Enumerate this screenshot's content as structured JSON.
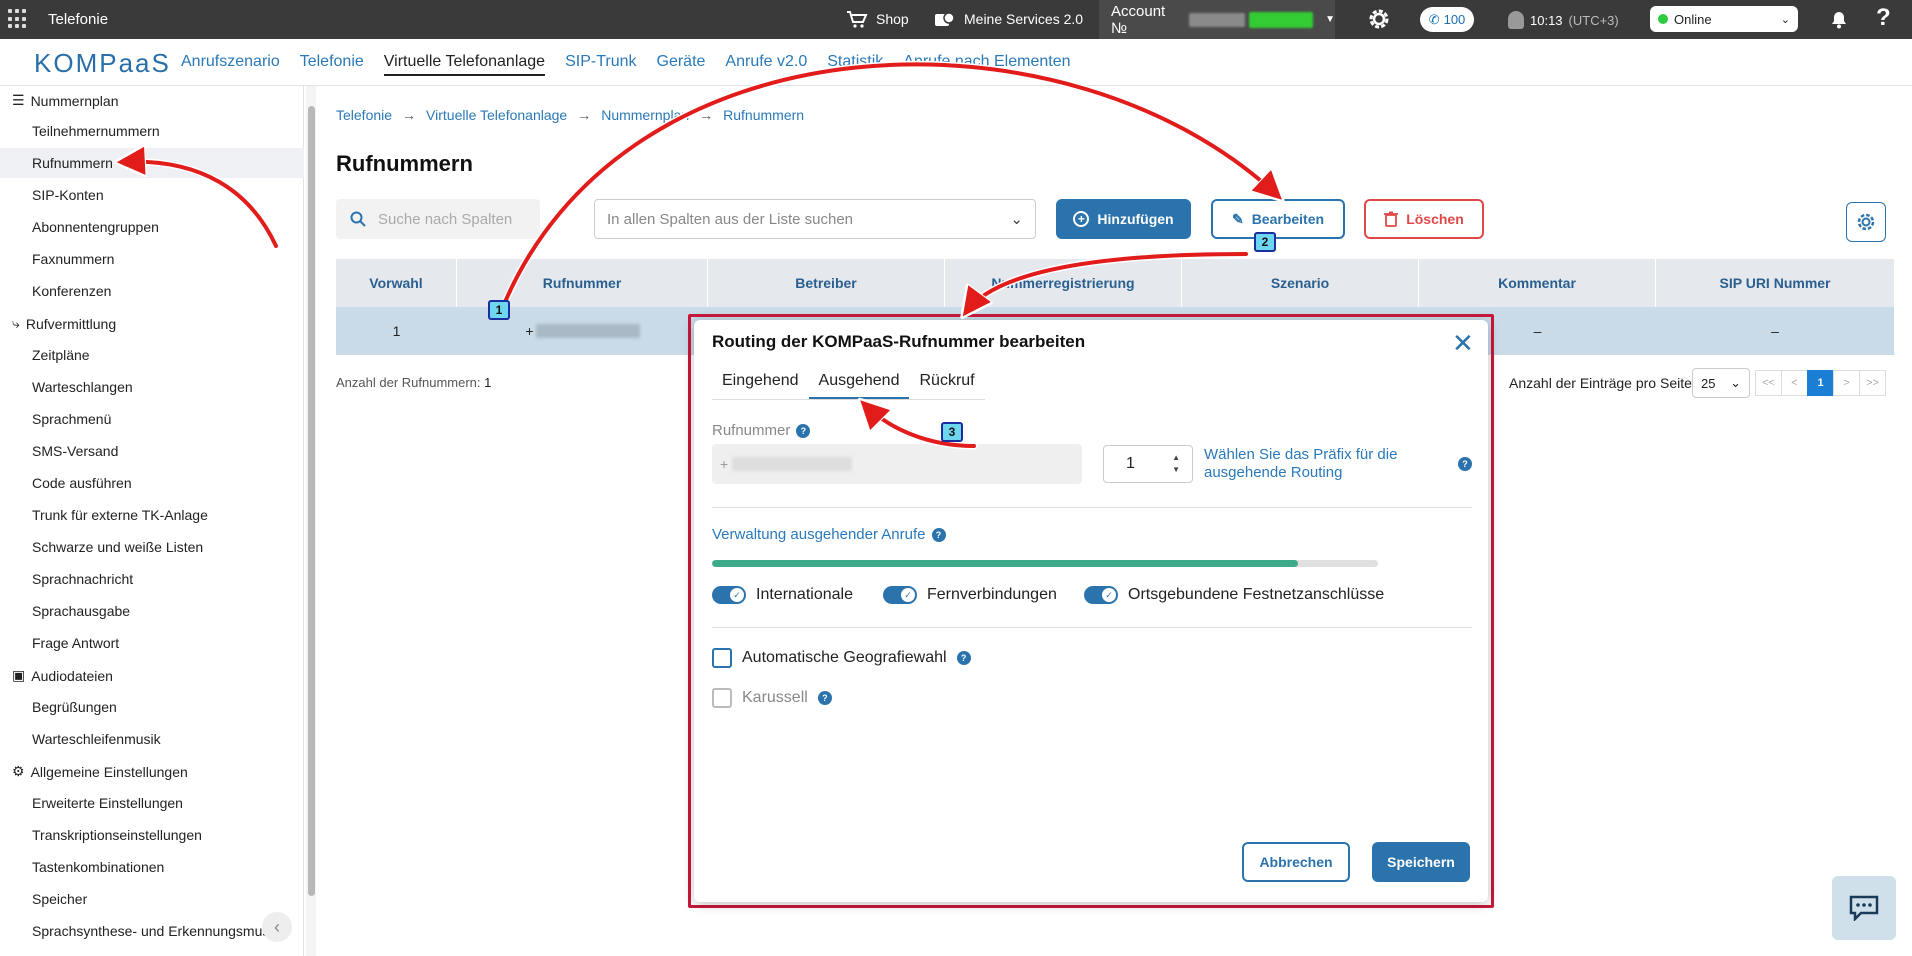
{
  "topbar": {
    "app_title": "Telefonie",
    "shop_label": "Shop",
    "services_label": "Meine Services 2.0",
    "account_label": "Account №",
    "phone_count": "100",
    "time": "10:13",
    "timezone": "(UTC+3)",
    "status": "Online"
  },
  "nav": {
    "logo": "KOMPaaS",
    "links": [
      "Anrufszenario",
      "Telefonie",
      "Virtuelle Telefonanlage",
      "SIP-Trunk",
      "Geräte",
      "Anrufe v2.0",
      "Statistik",
      "Anrufe nach Elementen"
    ],
    "active": "Virtuelle Telefonanlage"
  },
  "sidebar": {
    "groups": [
      {
        "label": "Nummernplan",
        "items": [
          "Teilnehmernummern",
          "Rufnummern",
          "SIP-Konten",
          "Abonnentengruppen",
          "Faxnummern",
          "Konferenzen"
        ]
      },
      {
        "label": "Rufvermittlung",
        "items": [
          "Zeitpläne",
          "Warteschlangen",
          "Sprachmenü",
          "SMS-Versand",
          "Code ausführen",
          "Trunk für externe TK-Anlage",
          "Schwarze und weiße Listen",
          "Sprachnachricht",
          "Sprachausgabe",
          "Frage Antwort"
        ]
      },
      {
        "label": "Audiodateien",
        "items": [
          "Begrüßungen",
          "Warteschleifenmusik"
        ]
      },
      {
        "label": "Allgemeine Einstellungen",
        "items": [
          "Erweiterte Einstellungen",
          "Transkriptionseinstellungen",
          "Tastenkombinationen",
          "Speicher",
          "Sprachsynthese- und Erkennungsmus"
        ]
      }
    ],
    "active_item": "Rufnummern"
  },
  "main": {
    "breadcrumb": [
      "Telefonie",
      "Virtuelle Telefonanlage",
      "Nummernplan",
      "Rufnummern"
    ],
    "title": "Rufnummern",
    "search_placeholder": "Suche nach Spalten",
    "combo_placeholder": "In allen Spalten aus der Liste suchen",
    "add_label": "Hinzufügen",
    "edit_label": "Bearbeiten",
    "delete_label": "Löschen",
    "table": {
      "headers": [
        "Vorwahl",
        "Rufnummer",
        "Betreiber",
        "Nummerregistrierung",
        "Szenario",
        "Kommentar",
        "SIP URI Nummer"
      ],
      "rows": [
        [
          "1",
          "+",
          "",
          "",
          "",
          "–",
          "–"
        ]
      ]
    },
    "count_label": "Anzahl der Rufnummern:",
    "count_value": "1",
    "per_page_label": "Anzahl der Einträge pro Seite",
    "per_page": "25",
    "pager": [
      "<<",
      "<",
      "1",
      ">",
      ">>"
    ]
  },
  "modal": {
    "title": "Routing der KOMPaaS-Rufnummer bearbeiten",
    "tabs": [
      "Eingehend",
      "Ausgehend",
      "Rückruf"
    ],
    "active_tab": "Ausgehend",
    "number_label": "Rufnummer",
    "number_prefix": "+",
    "prefix_value": "1",
    "prefix_hint": "Wählen Sie das Präfix für die ausgehende Routing",
    "outgoing_section": "Verwaltung ausgehender Anrufe",
    "progress_fraction": 0.88,
    "toggles": [
      "Internationale",
      "Fernverbindungen",
      "Ortsgebundene Festnetzanschlüsse"
    ],
    "checkbox_geo": "Automatische Geografiewahl",
    "checkbox_carousel": "Karussell",
    "cancel_label": "Abbrechen",
    "save_label": "Speichern",
    "help_glyph": "?"
  },
  "annotations": {
    "badges": [
      "1",
      "2",
      "3"
    ],
    "arrow_color": "#e21b1b"
  }
}
